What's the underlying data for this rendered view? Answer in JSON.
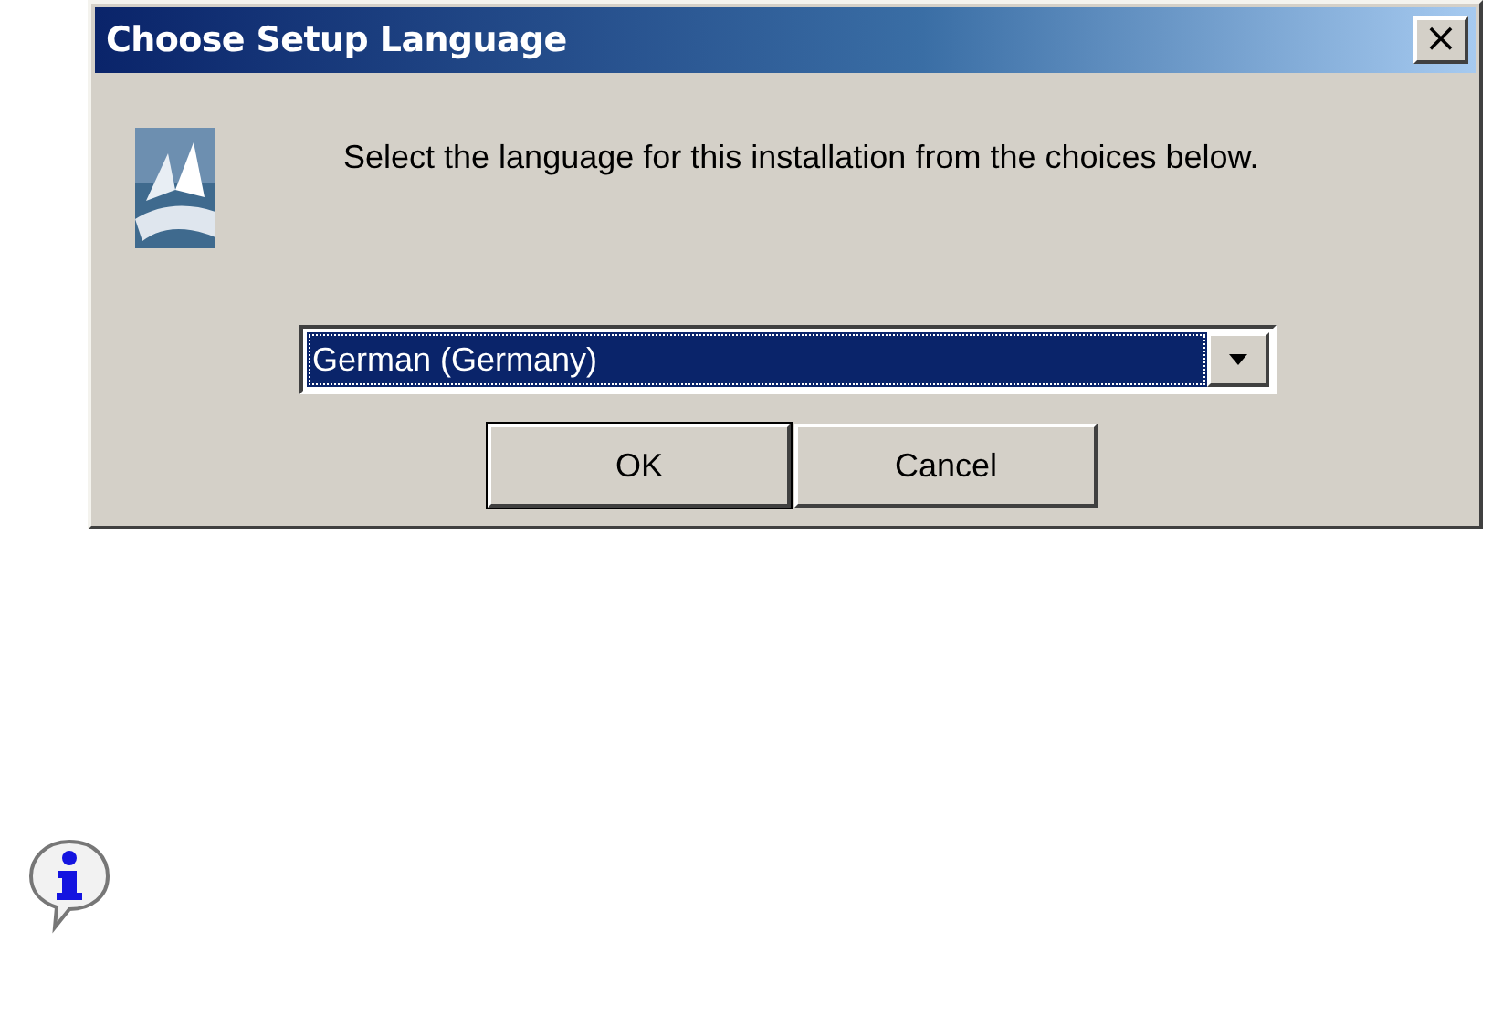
{
  "window": {
    "title": "Choose Setup Language",
    "close": "×"
  },
  "message": "Select the language for this installation from the choices below.",
  "language_select": {
    "value": "German (Germany)",
    "focused": true
  },
  "buttons": [
    {
      "label": "OK",
      "default": true
    },
    {
      "label": "Cancel",
      "default": false
    }
  ]
}
